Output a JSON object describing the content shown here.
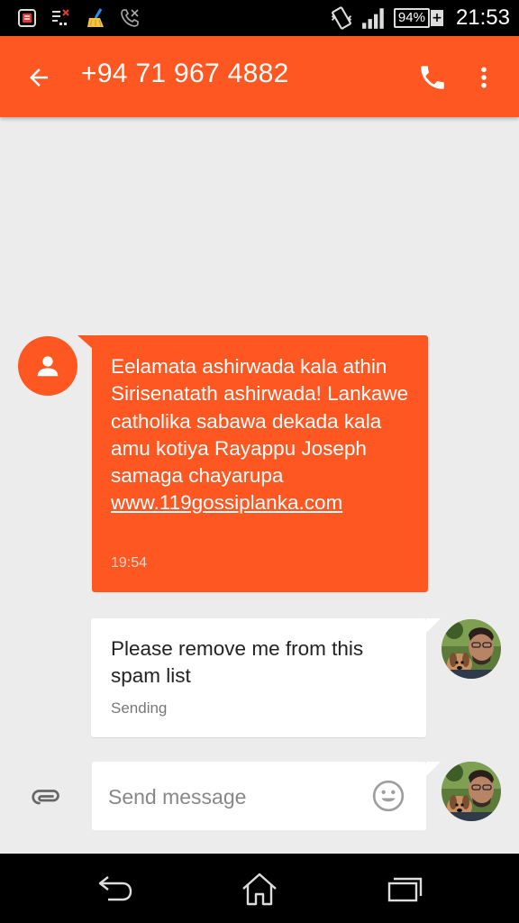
{
  "status_bar": {
    "battery_percent": "94%",
    "battery_plus": "+",
    "time": "21:53",
    "icons": [
      "task-manager-icon",
      "data-disabled-icon",
      "cleaner-broom-icon",
      "missed-call-icon",
      "vibrate-icon",
      "signal-strength-icon",
      "battery-icon"
    ]
  },
  "app_bar": {
    "title": "+94 71 967 4882",
    "icons": [
      "back-arrow-icon",
      "phone-icon",
      "more-vert-icon"
    ]
  },
  "conversation": {
    "incoming": {
      "text": "Eelamata ashirwada kala athin Sirisenatath ashirwada! Lankawe catholika sabawa dekada kala amu kotiya Rayappu Joseph samaga chayarupa",
      "link": "www.119gossiplanka.com",
      "time": "19:54"
    },
    "outgoing": {
      "text": "Please remove me from this spam list",
      "status": "Sending"
    }
  },
  "composer": {
    "placeholder": "Send message",
    "icons": [
      "attach-paperclip-icon",
      "emoji-icon"
    ]
  },
  "nav_bar": {
    "icons": [
      "back-nav-icon",
      "home-nav-icon",
      "recent-apps-icon"
    ]
  },
  "colors": {
    "accent": "#ff5722",
    "background": "#ececec",
    "bubble_outgoing": "#ffffff"
  }
}
